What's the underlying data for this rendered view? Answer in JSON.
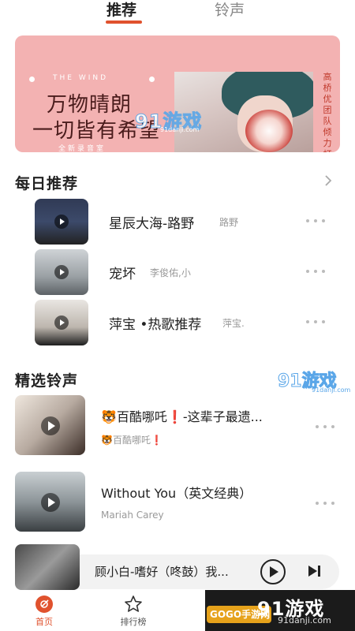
{
  "tabs": [
    {
      "label": "推荐",
      "active": true
    },
    {
      "label": "铃声",
      "active": false
    }
  ],
  "banner": {
    "subtitle": "THE WIND",
    "line1": "万物晴朗",
    "line2": "一切皆有希望",
    "tag": "全新录音室",
    "vertical_text": "高桥优团队倾力打造",
    "watermark": "91游戏",
    "watermark_small": "91danji.com"
  },
  "daily": {
    "title": "每日推荐",
    "items": [
      {
        "title": "星辰大海-路野",
        "artist": "路野"
      },
      {
        "title": "宠坏",
        "artist": "李俊佑,小"
      },
      {
        "title": "萍宝 •热歌推荐",
        "artist": "萍宝."
      }
    ]
  },
  "ringtones": {
    "title": "精选铃声",
    "items": [
      {
        "title": "🐯百酷哪吒❗-这辈子最遗...",
        "subtitle": "🐯百酷哪吒❗"
      },
      {
        "title": "Without You（英文经典）",
        "subtitle": "Mariah Carey"
      }
    ]
  },
  "watermark_mid": {
    "title": "91游戏",
    "url": "91danji.com"
  },
  "player": {
    "title": "顾小白-嗜好（咚鼓）我..."
  },
  "nav": [
    {
      "label": "首页",
      "icon": "home-disc-icon",
      "active": true
    },
    {
      "label": "排行榜",
      "icon": "star-icon",
      "active": false
    }
  ],
  "corner": {
    "gogo": "GOGO手游网",
    "brand": "91游戏",
    "url": "91danji.com"
  },
  "colors": {
    "accent": "#e0522e",
    "banner_bg": "#f3b2b2"
  }
}
